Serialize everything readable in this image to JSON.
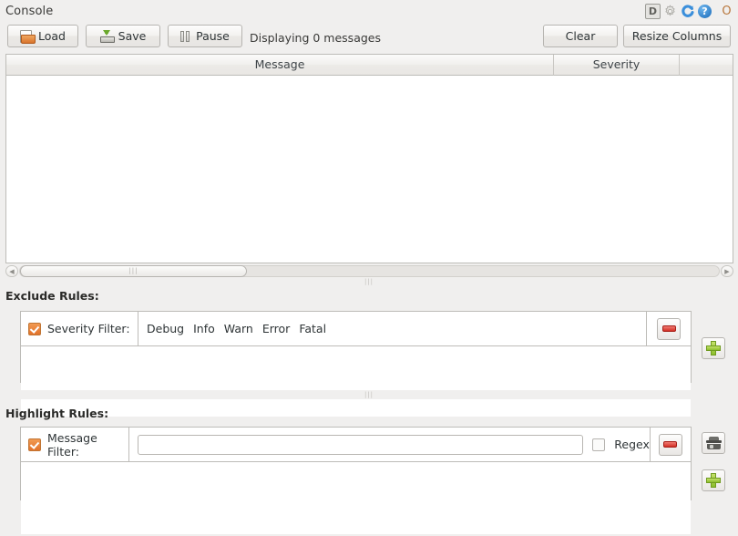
{
  "window": {
    "title": "Console",
    "icons": [
      {
        "name": "debug-icon",
        "glyph": "D"
      },
      {
        "name": "gear-icon",
        "glyph": "⚙"
      },
      {
        "name": "refresh-icon",
        "glyph": "↻"
      },
      {
        "name": "help-icon",
        "glyph": "?"
      },
      {
        "name": "options-icon",
        "glyph": "O"
      }
    ]
  },
  "toolbar": {
    "load_label": "Load",
    "save_label": "Save",
    "pause_label": "Pause",
    "status": "Displaying 0 messages",
    "clear_label": "Clear",
    "resize_columns_label": "Resize Columns"
  },
  "table": {
    "columns": [
      "Message",
      "Severity",
      ""
    ],
    "rows": []
  },
  "scrollbar": {
    "left_arrow": "◀",
    "right_arrow": "▶",
    "grip": "⫿e"
  },
  "exclude_rules": {
    "heading": "Exclude Rules:",
    "rows": [
      {
        "enabled": true,
        "label": "Severity Filter:",
        "severities": [
          "Debug",
          "Info",
          "Warn",
          "Error",
          "Fatal"
        ],
        "remove_tooltip": "Remove rule"
      }
    ],
    "add_tooltip": "Add rule"
  },
  "highlight_rules": {
    "heading": "Highlight Rules:",
    "rows": [
      {
        "enabled": true,
        "label": "Message Filter:",
        "value": "",
        "placeholder": "",
        "regex_label": "Regex",
        "regex_checked": false,
        "remove_tooltip": "Remove rule"
      }
    ],
    "color_tooltip": "Choose highlight color",
    "add_tooltip": "Add rule"
  },
  "colors": {
    "accent_orange": "#e2722a",
    "remove_red": "#d32f25",
    "add_green": "#8cbf2c",
    "window_bg": "#f0efee",
    "panel_bg": "#ffffff",
    "border": "#bdbcb8"
  }
}
